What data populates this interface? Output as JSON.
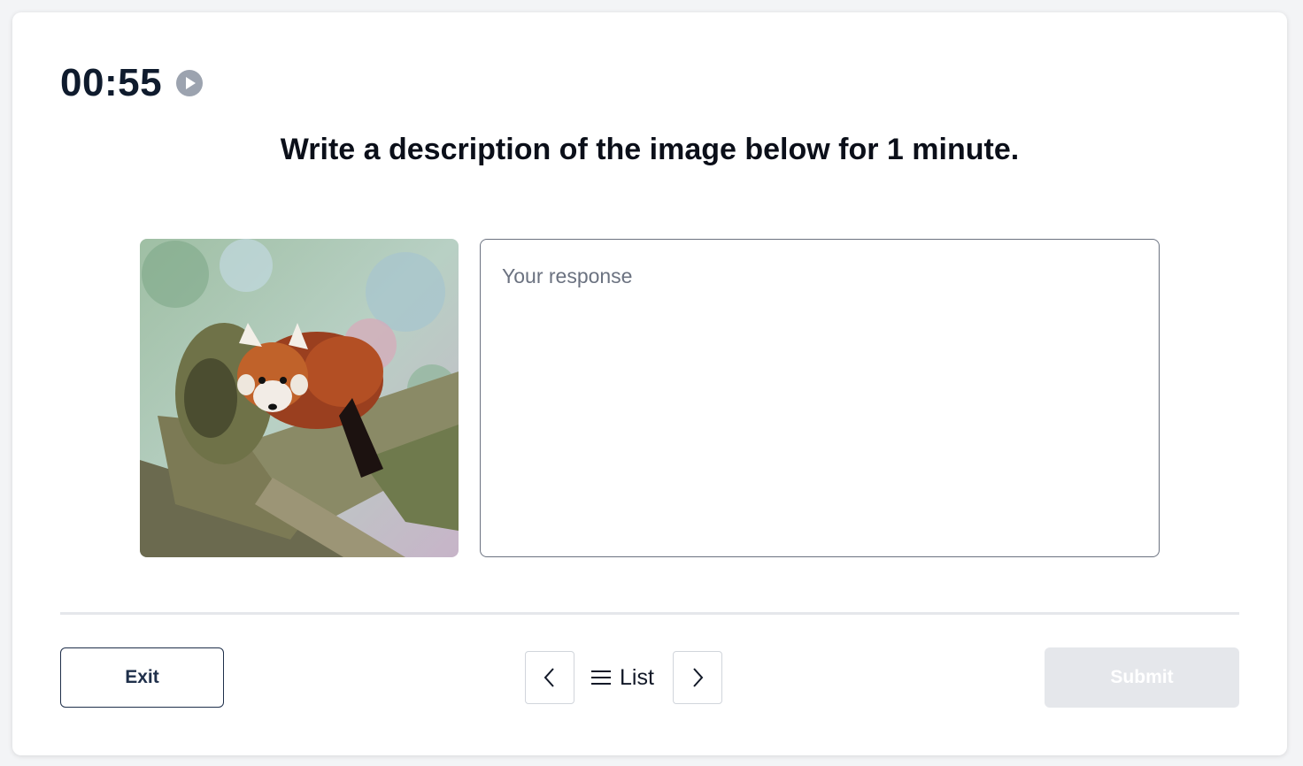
{
  "timer": {
    "time": "00:55",
    "play_icon": "play-circle-icon"
  },
  "question": {
    "prompt": "Write a description of the image below for 1 minute."
  },
  "image": {
    "subject": "red-panda-photo"
  },
  "response": {
    "placeholder": "Your response",
    "value": ""
  },
  "footer": {
    "exit_label": "Exit",
    "prev_icon": "chevron-left-icon",
    "list_label": "List",
    "list_icon": "hamburger-menu-icon",
    "next_icon": "chevron-right-icon",
    "submit_label": "Submit",
    "submit_enabled": false
  },
  "colors": {
    "timer_text": "#0f1b2d",
    "submit_disabled_bg": "#e5e7eb",
    "exit_border": "#1f2f4a"
  }
}
